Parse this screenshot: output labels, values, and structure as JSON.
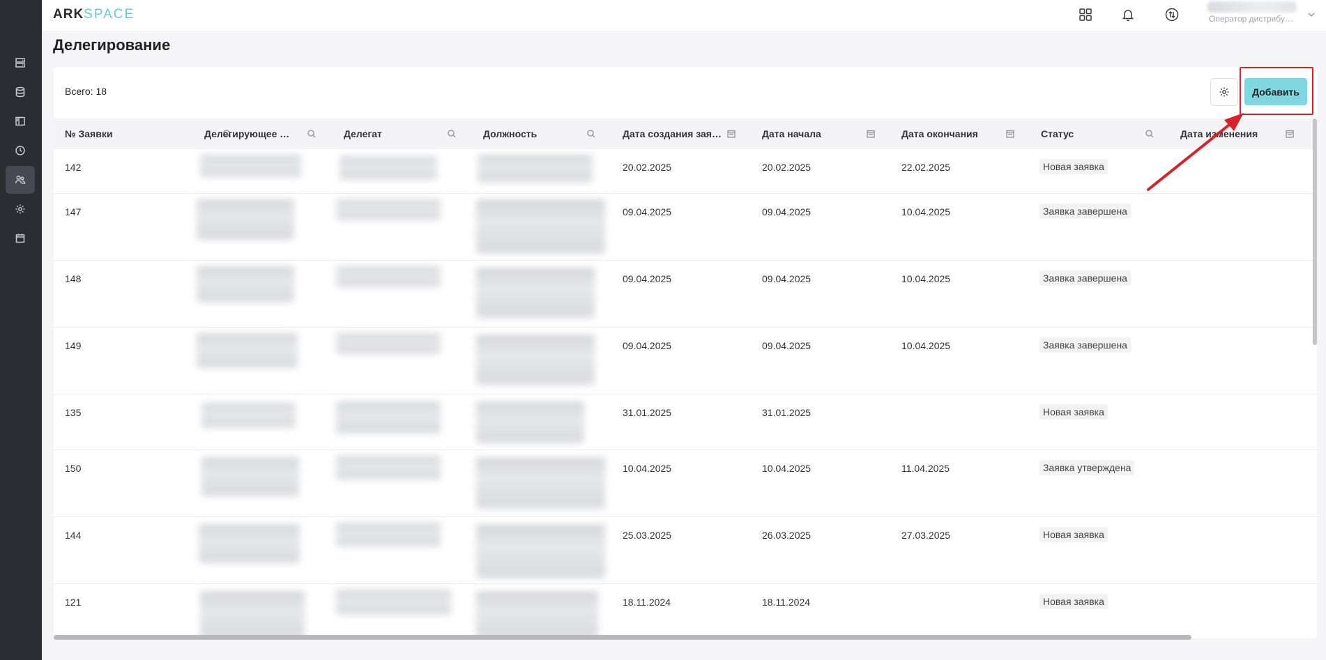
{
  "app": {
    "logo_ark": "ARK",
    "logo_space": "SPACE"
  },
  "header": {
    "user_role": "Оператор дистрибу…",
    "icons": [
      "apps-grid-icon",
      "bell-icon",
      "swap-icon",
      "chevron-down-icon"
    ]
  },
  "sidebar": {
    "items": [
      {
        "icon": "server-icon"
      },
      {
        "icon": "database-icon"
      },
      {
        "icon": "layout-icon"
      },
      {
        "icon": "clock-icon"
      },
      {
        "icon": "users-icon",
        "active": true
      },
      {
        "icon": "gear-icon"
      },
      {
        "icon": "calendar-icon"
      }
    ]
  },
  "page": {
    "title": "Делегирование"
  },
  "toolbar": {
    "total": "Всего: 18",
    "add_label": "Добавить"
  },
  "table": {
    "columns": [
      "№ Заявки",
      "Делегирующее л…",
      "Делегат",
      "Должность",
      "Дата создания заяв…",
      "Дата начала",
      "Дата окончания",
      "Статус",
      "Дата изменения"
    ],
    "rows": [
      {
        "id": "142",
        "created": "20.02.2025",
        "start": "20.02.2025",
        "end": "22.02.2025",
        "status": "Новая заявка"
      },
      {
        "id": "147",
        "created": "09.04.2025",
        "start": "09.04.2025",
        "end": "10.04.2025",
        "status": "Заявка завершена"
      },
      {
        "id": "148",
        "created": "09.04.2025",
        "start": "09.04.2025",
        "end": "10.04.2025",
        "status": "Заявка завершена"
      },
      {
        "id": "149",
        "created": "09.04.2025",
        "start": "09.04.2025",
        "end": "10.04.2025",
        "status": "Заявка завершена"
      },
      {
        "id": "135",
        "created": "31.01.2025",
        "start": "31.01.2025",
        "end": "",
        "status": "Новая заявка"
      },
      {
        "id": "150",
        "created": "10.04.2025",
        "start": "10.04.2025",
        "end": "11.04.2025",
        "status": "Заявка утверждена"
      },
      {
        "id": "144",
        "created": "25.03.2025",
        "start": "26.03.2025",
        "end": "27.03.2025",
        "status": "Новая заявка"
      },
      {
        "id": "121",
        "created": "18.11.2024",
        "start": "18.11.2024",
        "end": "",
        "status": "Новая заявка"
      }
    ]
  },
  "colors": {
    "sidebar_bg": "#2c2d33",
    "accent": "#7fd8df",
    "highlight": "#d9212a"
  }
}
